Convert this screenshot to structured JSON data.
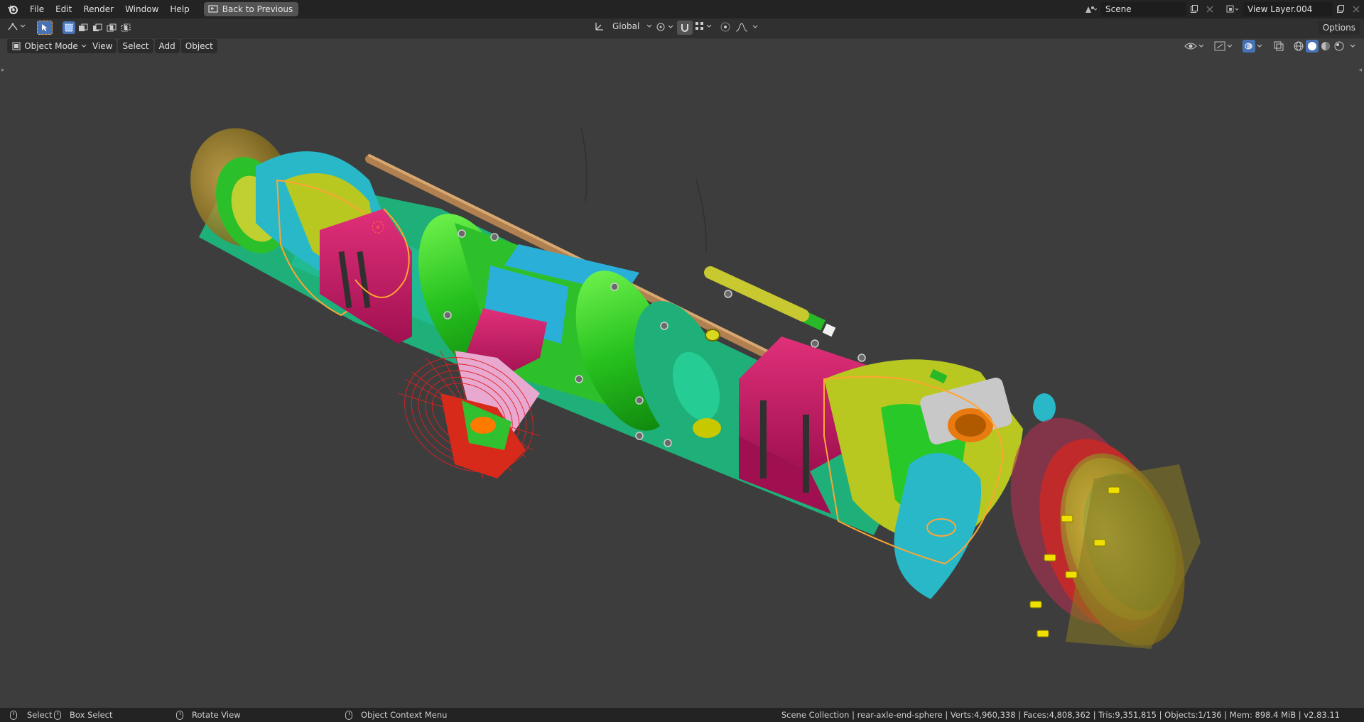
{
  "topbar": {
    "menus": [
      "File",
      "Edit",
      "Render",
      "Window",
      "Help"
    ],
    "back_label": "Back to Previous",
    "scene_value": "Scene",
    "view_layer_value": "View Layer.004"
  },
  "tool_header": {
    "orientation_value": "Global",
    "options_label": "Options"
  },
  "viewport_header": {
    "mode_value": "Object Mode",
    "menus": [
      "View",
      "Select",
      "Add",
      "Object"
    ]
  },
  "status_bar": {
    "select_label": "Select",
    "box_select_label": "Box Select",
    "rotate_label": "Rotate View",
    "context_menu_label": "Object Context Menu",
    "stats": "Scene Collection | rear-axle-end-sphere | Verts:4,960,338 | Faces:4,808,362 | Tris:9,351,815 | Objects:1/136 | Mem: 898.4 MiB | v2.83.11"
  },
  "colors": {
    "bg_viewport": "#3d3d3d",
    "topbar": "#232323",
    "selection_outline": "#ffa533",
    "active_blue": "#4772b3"
  },
  "icons": [
    "blender-logo-icon",
    "editor-type-icon",
    "select-cursor-icon",
    "select-box-mode-icons",
    "transform-orientation-icon",
    "pivot-icon",
    "snap-icon",
    "proportional-icon",
    "visibility-icon",
    "gizmo-icon",
    "overlay-icon",
    "xray-icon",
    "shading-wireframe-icon",
    "shading-solid-icon",
    "shading-material-icon",
    "shading-rendered-icon"
  ]
}
